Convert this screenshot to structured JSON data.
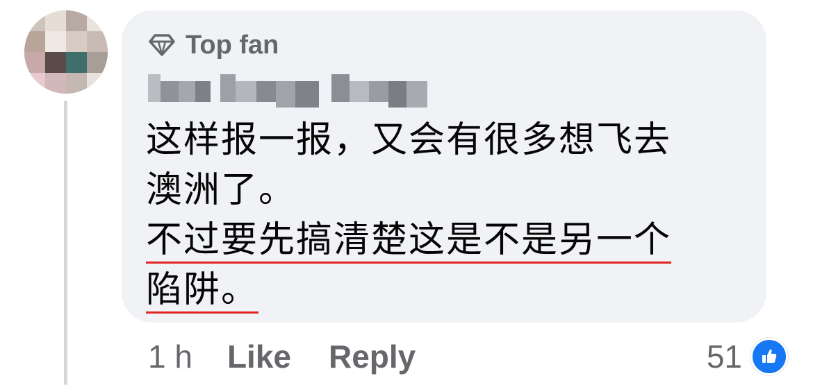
{
  "comment": {
    "badge_label": "Top fan",
    "badge_icon": "diamond-icon",
    "text_lines": [
      "这样报一报，又会有很多想飞去",
      "澳洲了。",
      "不过要先搞清楚这是不是另一个",
      "陷阱。"
    ]
  },
  "footer": {
    "time": "1 h",
    "like_label": "Like",
    "reply_label": "Reply",
    "reaction_count": "51",
    "reaction_icon": "like-reaction-icon"
  },
  "colors": {
    "bubble": "#f0f2f5",
    "muted_text": "#65676b",
    "body_text": "#050505",
    "underline": "#e02424",
    "like_blue": "#1877f2"
  }
}
